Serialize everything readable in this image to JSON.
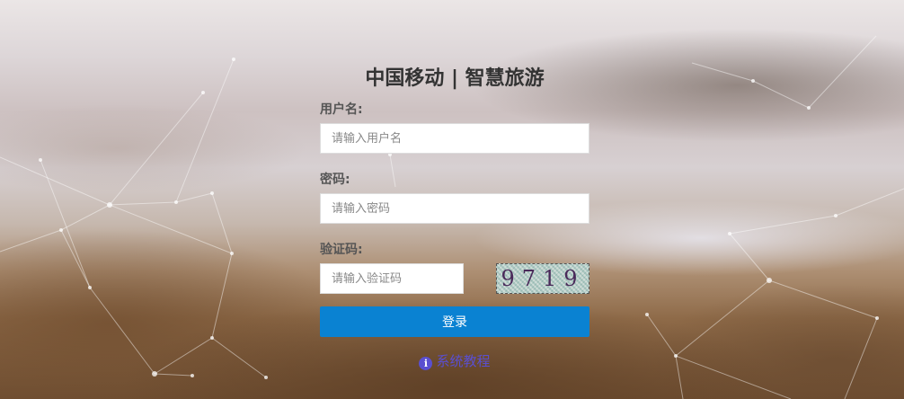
{
  "app": {
    "title": "中国移动 | 智慧旅游"
  },
  "form": {
    "username": {
      "label": "用户名:",
      "placeholder": "请输入用户名",
      "value": ""
    },
    "password": {
      "label": "密码:",
      "placeholder": "请输入密码",
      "value": ""
    },
    "captcha": {
      "label": "验证码:",
      "placeholder": "请输入验证码",
      "value": "",
      "image_text": "9719"
    },
    "login_button": "登录"
  },
  "help": {
    "icon": "info-icon",
    "icon_glyph": "i",
    "label": "系统教程"
  },
  "colors": {
    "button": "#0a82d2",
    "help_link": "#5a4fd0",
    "title": "#333333"
  }
}
